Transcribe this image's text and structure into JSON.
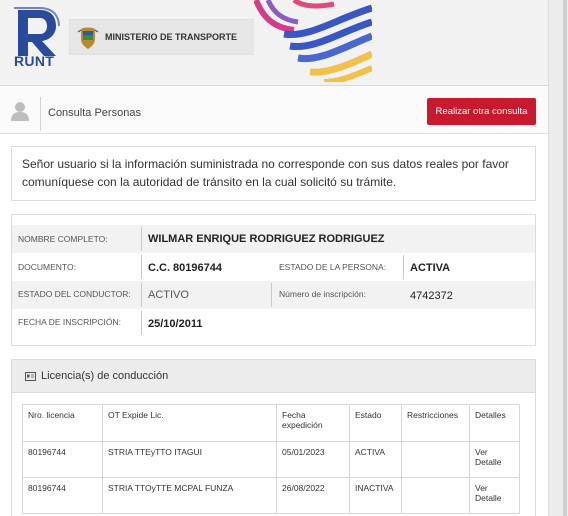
{
  "header": {
    "logo_text": "RUNT",
    "ministry": "MINISTERIO DE TRANSPORTE"
  },
  "consulta": {
    "title": "Consulta Personas",
    "button": "Realizar otra consulta"
  },
  "notice": "Señor usuario si la información suministrada no corresponde con sus datos reales por favor comuníquese con la autoridad de tránsito en la cual solicitó su trámite.",
  "persona": {
    "nombre_label": "NOMBRE COMPLETO:",
    "nombre_value": "WILMAR ENRIQUE RODRIGUEZ RODRIGUEZ",
    "documento_label": "DOCUMENTO:",
    "documento_value": "C.C. 80196744",
    "estado_persona_label": "ESTADO DE LA PERSONA:",
    "estado_persona_value": "ACTIVA",
    "estado_conductor_label": "ESTADO DEL CONDUCTOR:",
    "estado_conductor_value": "ACTIVO",
    "inscripcion_label": "Número de inscripción:",
    "inscripcion_value": "4742372",
    "fecha_label": "FECHA DE INSCRIPCIÓN:",
    "fecha_value": "25/10/2011"
  },
  "licencias": {
    "title": "Licencia(s) de conducción",
    "columns": [
      "Nro. licencia",
      "OT Expide Lic.",
      "Fecha expedición",
      "Estado",
      "Restricciones",
      "Detalles"
    ],
    "rows": [
      {
        "nro": "80196744",
        "ot": "STRIA TTEyTTO ITAGUI",
        "fecha": "05/01/2023",
        "estado": "ACTIVA",
        "restricciones": "",
        "detalle": "Ver Detalle"
      },
      {
        "nro": "80196744",
        "ot": "STRIA TTOyTTE MCPAL FUNZA",
        "fecha": "26/08/2022",
        "estado": "INACTIVA",
        "restricciones": "",
        "detalle": "Ver Detalle"
      }
    ]
  },
  "colors": {
    "accent_red": "#c8192e",
    "runt_blue": "#2b4a9b"
  },
  "icons": {
    "logo": "runt-logo",
    "ministry": "escudo-icon",
    "user": "user-icon",
    "license": "id-card-icon"
  }
}
